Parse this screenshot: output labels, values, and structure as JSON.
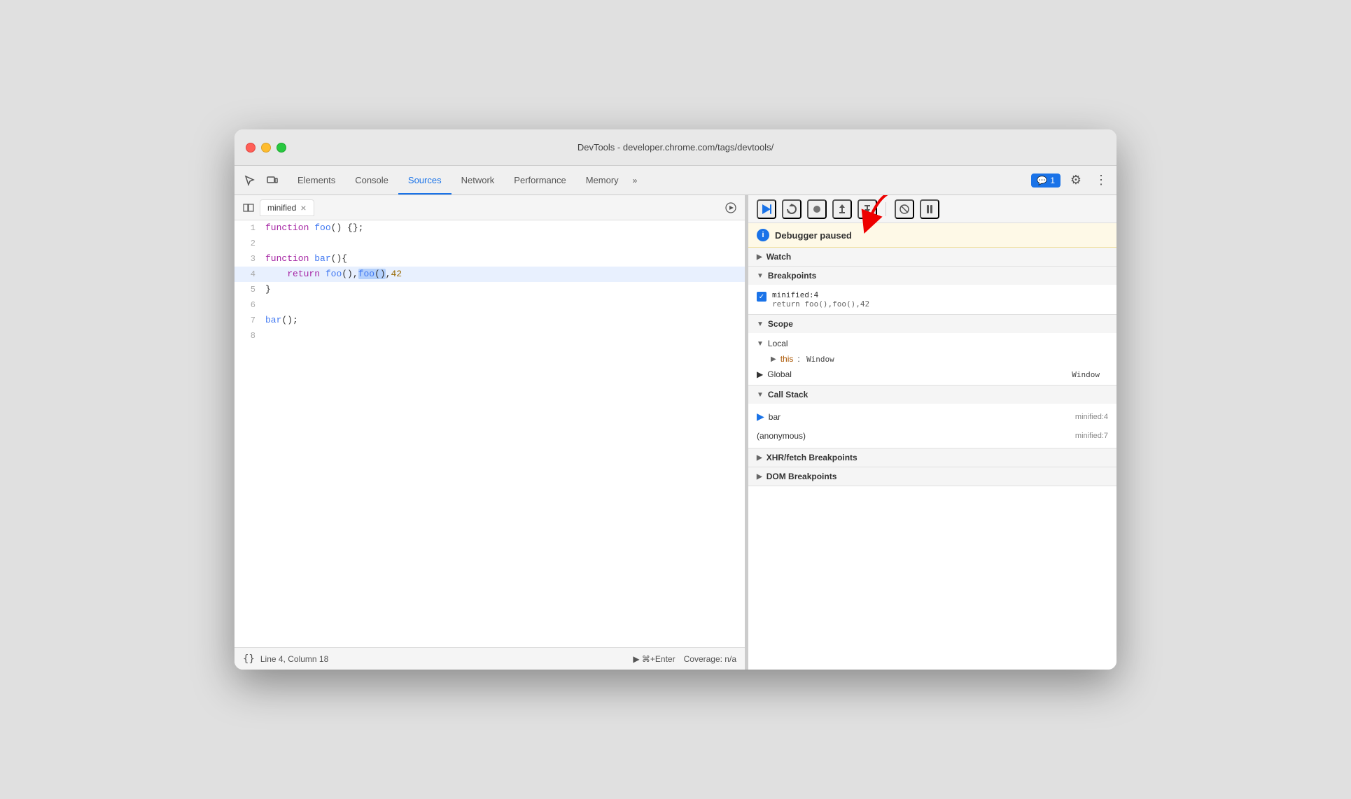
{
  "window": {
    "title": "DevTools - developer.chrome.com/tags/devtools/"
  },
  "tabs": {
    "items": [
      {
        "label": "Elements",
        "active": false
      },
      {
        "label": "Console",
        "active": false
      },
      {
        "label": "Sources",
        "active": true
      },
      {
        "label": "Network",
        "active": false
      },
      {
        "label": "Performance",
        "active": false
      },
      {
        "label": "Memory",
        "active": false
      }
    ],
    "more_label": "»",
    "badge_label": "1",
    "settings_icon": "⚙",
    "menu_icon": "⋮"
  },
  "editor": {
    "file_tab": "minified",
    "close_icon": "×",
    "run_icon": "▶",
    "lines": [
      {
        "num": 1,
        "content": "function foo() {};",
        "highlighted": false
      },
      {
        "num": 2,
        "content": "",
        "highlighted": false
      },
      {
        "num": 3,
        "content": "function bar(){",
        "highlighted": false
      },
      {
        "num": 4,
        "content": "    return foo(),foo(),42",
        "highlighted": true
      },
      {
        "num": 5,
        "content": "}",
        "highlighted": false
      },
      {
        "num": 6,
        "content": "",
        "highlighted": false
      },
      {
        "num": 7,
        "content": "bar();",
        "highlighted": false
      },
      {
        "num": 8,
        "content": "",
        "highlighted": false
      }
    ]
  },
  "status_bar": {
    "format_icon": "{}",
    "position": "Line 4, Column 18",
    "run_label": "▶  ⌘+Enter",
    "coverage": "Coverage: n/a"
  },
  "debugger": {
    "paused_text": "Debugger paused",
    "buttons": [
      {
        "icon": "▶",
        "label": "resume",
        "active": true
      },
      {
        "icon": "↺",
        "label": "step-over"
      },
      {
        "icon": "●",
        "label": "step"
      },
      {
        "icon": "↑",
        "label": "step-out"
      },
      {
        "icon": "→",
        "label": "step-into"
      },
      {
        "icon": "⊘",
        "label": "deactivate"
      },
      {
        "icon": "⏸",
        "label": "pause-on-exceptions"
      }
    ]
  },
  "panels": {
    "watch": {
      "label": "Watch"
    },
    "breakpoints": {
      "label": "Breakpoints",
      "items": [
        {
          "location": "minified:4",
          "code": "return foo(),foo(),42"
        }
      ]
    },
    "scope": {
      "label": "Scope",
      "local": {
        "label": "Local",
        "items": [
          {
            "key": "this",
            "value": "Window",
            "expandable": true
          }
        ]
      },
      "global": {
        "label": "Global",
        "value": "Window"
      }
    },
    "call_stack": {
      "label": "Call Stack",
      "items": [
        {
          "name": "bar",
          "location": "minified:4",
          "current": true
        },
        {
          "name": "(anonymous)",
          "location": "minified:7",
          "current": false
        }
      ]
    },
    "xhr_breakpoints": {
      "label": "XHR/fetch Breakpoints"
    },
    "dom_breakpoints": {
      "label": "DOM Breakpoints"
    }
  }
}
